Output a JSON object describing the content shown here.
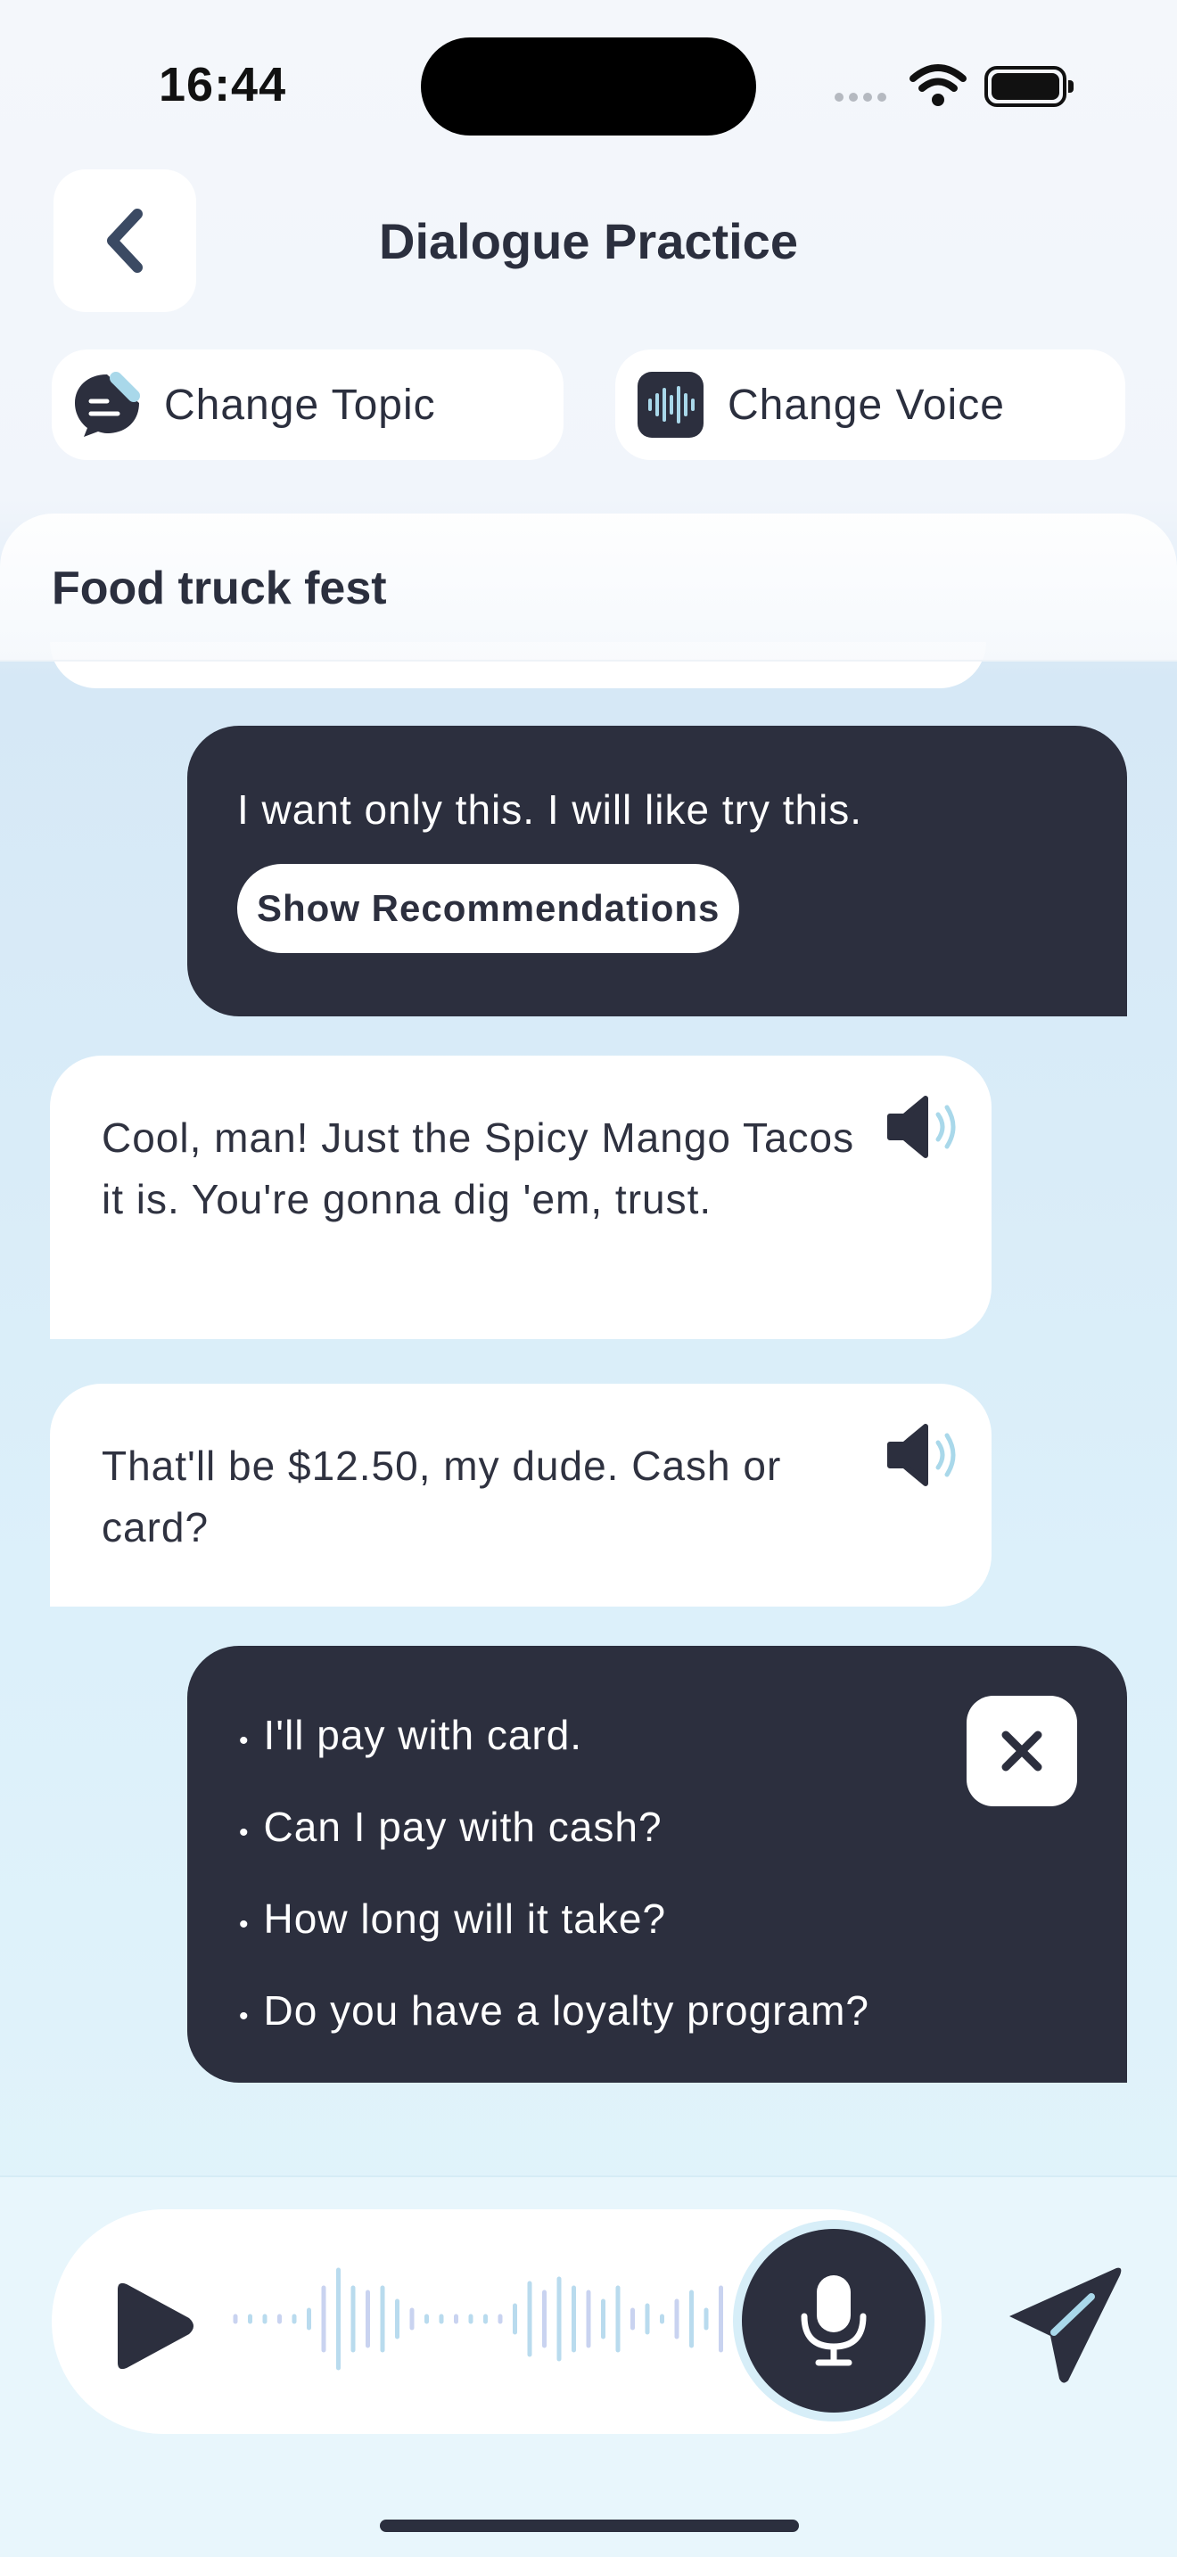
{
  "status_bar": {
    "time": "16:44"
  },
  "header": {
    "title": "Dialogue Practice"
  },
  "actions": {
    "change_topic": "Change Topic",
    "change_voice": "Change Voice"
  },
  "topic": {
    "title": "Food truck fest"
  },
  "messages": [
    {
      "role": "user",
      "text": "I want only this. I will like try this.",
      "button": "Show Recommendations"
    },
    {
      "role": "assistant",
      "text": "Cool, man! Just the Spicy Mango Tacos it is. You're gonna dig 'em, trust."
    },
    {
      "role": "assistant",
      "text": "That'll be $12.50, my dude. Cash or card?"
    }
  ],
  "suggestions": [
    "I'll pay with card.",
    "Can I pay with cash?",
    "How long will it take?",
    "Do you have a loyalty program?"
  ],
  "colors": {
    "dark": "#2c2f3e",
    "accent": "#a9d8ea",
    "background": "#dcf0fa"
  },
  "icons": [
    "chevron-left-icon",
    "chat-edit-icon",
    "voice-wave-icon",
    "speaker-icon",
    "close-icon",
    "play-icon",
    "waveform-icon",
    "microphone-icon",
    "send-icon"
  ]
}
